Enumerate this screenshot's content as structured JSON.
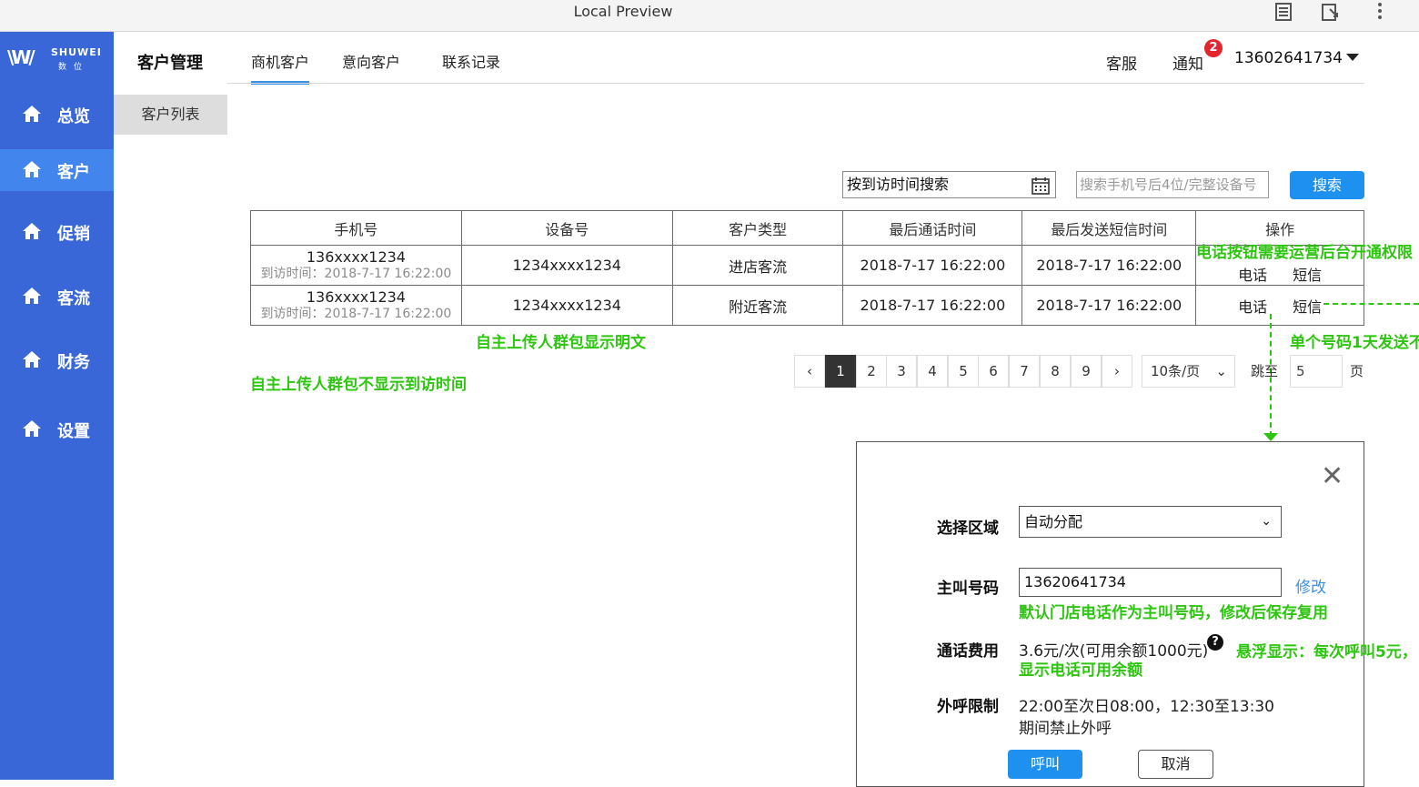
{
  "window": {
    "title": "Local Preview"
  },
  "sidebar": {
    "logo_text": "SHUWEI",
    "logo_sub": "数位",
    "items": [
      {
        "label": "总览"
      },
      {
        "label": "客户"
      },
      {
        "label": "促销"
      },
      {
        "label": "客流"
      },
      {
        "label": "财务"
      },
      {
        "label": "设置"
      }
    ]
  },
  "subsidebar": {
    "heading": "客户管理",
    "item": "客户列表"
  },
  "tabs": [
    {
      "label": "商机客户"
    },
    {
      "label": "意向客户"
    },
    {
      "label": "联系记录"
    }
  ],
  "header": {
    "service": "客服",
    "notice": "通知",
    "notice_count": "2",
    "user": "13602641734"
  },
  "filters": {
    "date_placeholder": "按到访时间搜索",
    "search_placeholder": "搜索手机号后4位/完整设备号",
    "search_button": "搜索"
  },
  "table": {
    "headers": [
      "手机号",
      "设备号",
      "客户类型",
      "最后通话时间",
      "最后发送短信时间",
      "操作"
    ],
    "rows": [
      {
        "phone": "136xxxx1234",
        "visit": "到访时间：2018-7-17 16:22:00",
        "device": "1234xxxx1234",
        "type": "进店客流",
        "last_call": "2018-7-17 16:22:00",
        "last_sms": "2018-7-17 16:22:00",
        "op_call": "电话",
        "op_sms": "短信"
      },
      {
        "phone": "136xxxx1234",
        "visit": "到访时间：2018-7-17 16:22:00",
        "device": "1234xxxx1234",
        "type": "附近客流",
        "last_call": "2018-7-17 16:22:00",
        "last_sms": "2018-7-17 16:22:00",
        "op_call": "电话",
        "op_sms": "短信"
      }
    ]
  },
  "annotations": {
    "a1": "电话按钮需要运营后台开通权限",
    "a2": "自主上传人群包显示明文",
    "a3": "单个号码1天发送不",
    "a4": "自主上传人群包不显示到访时间",
    "a5": "默认门店电话作为主叫号码，修改后保存复用",
    "a6_line1": "悬浮显示：每次呼叫5元，",
    "a6_line2": "显示电话可用余额"
  },
  "pagination": {
    "prev": "‹",
    "next": "›",
    "pages": [
      "1",
      "2",
      "3",
      "4",
      "5",
      "6",
      "7",
      "8",
      "9"
    ],
    "current": "1",
    "page_size": "10条/页",
    "jump_label": "跳至",
    "jump_value": "5",
    "page_unit": "页"
  },
  "dialog": {
    "close": "✕",
    "region_label": "选择区域",
    "region_value": "自动分配",
    "caller_label": "主叫号码",
    "caller_value": "13620641734",
    "edit_link": "修改",
    "fee_label": "通话费用",
    "fee_value": "3.6元/次(可用余额1000元)",
    "help": "?",
    "limit_label": "外呼限制",
    "limit_line1": "22:00至次日08:00，12:30至13:30",
    "limit_line2": "期间禁止外呼",
    "call_button": "呼叫",
    "cancel_button": "取消"
  },
  "colors": {
    "sidebar": "#3a67d8",
    "sidebar_active": "#4285ec",
    "primary": "#1e90f0",
    "annotation": "#2ec511"
  }
}
